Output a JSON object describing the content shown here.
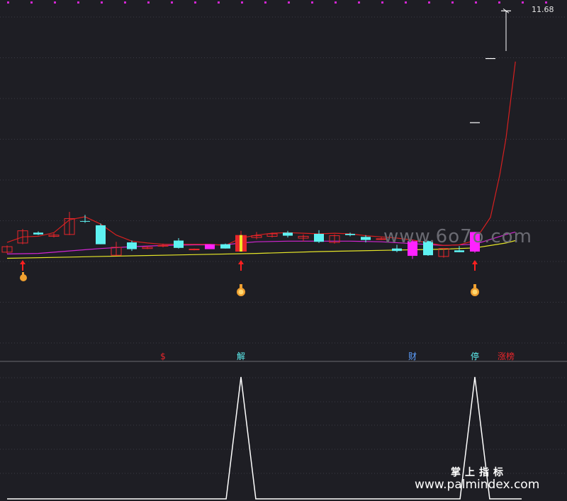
{
  "chart_data": [
    {
      "type": "candlestick",
      "title": "",
      "ylim": [
        6.0,
        11.8
      ],
      "price_high_label": "11.68",
      "colors": {
        "up": "#e8262b",
        "down": "#5ef2f2",
        "limit_up": "#ff22ff",
        "ma_short": "#d62020",
        "ma_mid": "#d226d2",
        "ma_long": "#e6e628",
        "grid": "#3a3a44",
        "separator": "#6a6a70"
      },
      "candles": [
        {
          "i": 0,
          "o": 7.73,
          "c": 7.82,
          "h": 7.84,
          "l": 7.71,
          "dir": "up"
        },
        {
          "i": 1,
          "o": 7.88,
          "c": 8.08,
          "h": 8.11,
          "l": 7.86,
          "dir": "up"
        },
        {
          "i": 2,
          "o": 8.05,
          "c": 8.02,
          "h": 8.07,
          "l": 8.01,
          "dir": "down"
        },
        {
          "i": 3,
          "o": 7.99,
          "c": 8.01,
          "h": 8.04,
          "l": 7.97,
          "dir": "up"
        },
        {
          "i": 4,
          "o": 8.02,
          "c": 8.28,
          "h": 8.39,
          "l": 8.01,
          "dir": "up"
        },
        {
          "i": 5,
          "o": 8.24,
          "c": 8.23,
          "h": 8.34,
          "l": 8.21,
          "dir": "down"
        },
        {
          "i": 6,
          "o": 8.17,
          "c": 7.86,
          "h": 8.2,
          "l": 7.86,
          "dir": "down"
        },
        {
          "i": 7,
          "o": 7.68,
          "c": 7.81,
          "h": 7.9,
          "l": 7.67,
          "dir": "up"
        },
        {
          "i": 8,
          "o": 7.89,
          "c": 7.78,
          "h": 7.92,
          "l": 7.75,
          "dir": "down"
        },
        {
          "i": 9,
          "o": 7.79,
          "c": 7.81,
          "h": 7.83,
          "l": 7.78,
          "dir": "up"
        },
        {
          "i": 10,
          "o": 7.83,
          "c": 7.84,
          "h": 7.87,
          "l": 7.81,
          "dir": "up"
        },
        {
          "i": 11,
          "o": 7.92,
          "c": 7.8,
          "h": 7.96,
          "l": 7.79,
          "dir": "down"
        },
        {
          "i": 12,
          "o": 7.77,
          "c": 7.78,
          "h": 7.79,
          "l": 7.76,
          "dir": "up"
        },
        {
          "i": 13,
          "o": 7.78,
          "c": 7.86,
          "h": 7.86,
          "l": 7.78,
          "dir": "limit_up"
        },
        {
          "i": 14,
          "o": 7.86,
          "c": 7.79,
          "h": 7.87,
          "l": 7.79,
          "dir": "down"
        },
        {
          "i": 15,
          "o": 7.74,
          "c": 8.01,
          "h": 8.08,
          "l": 7.74,
          "dir": "up",
          "highlight": true
        },
        {
          "i": 16,
          "o": 7.97,
          "c": 8.0,
          "h": 8.06,
          "l": 7.94,
          "dir": "up"
        },
        {
          "i": 17,
          "o": 7.99,
          "c": 8.03,
          "h": 8.05,
          "l": 7.97,
          "dir": "up"
        },
        {
          "i": 18,
          "o": 8.05,
          "c": 8.0,
          "h": 8.08,
          "l": 7.97,
          "dir": "down"
        },
        {
          "i": 19,
          "o": 7.96,
          "c": 7.99,
          "h": 8.02,
          "l": 7.91,
          "dir": "up"
        },
        {
          "i": 20,
          "o": 8.03,
          "c": 7.9,
          "h": 8.09,
          "l": 7.88,
          "dir": "down"
        },
        {
          "i": 21,
          "o": 7.89,
          "c": 8.0,
          "h": 8.02,
          "l": 7.87,
          "dir": "up"
        },
        {
          "i": 22,
          "o": 8.03,
          "c": 8.01,
          "h": 8.05,
          "l": 7.99,
          "dir": "down"
        },
        {
          "i": 23,
          "o": 7.98,
          "c": 7.93,
          "h": 8.01,
          "l": 7.89,
          "dir": "down"
        },
        {
          "i": 24,
          "o": 7.94,
          "c": 7.95,
          "h": 7.97,
          "l": 7.93,
          "dir": "up"
        },
        {
          "i": 25,
          "o": 7.79,
          "c": 7.75,
          "h": 7.85,
          "l": 7.73,
          "dir": "down"
        },
        {
          "i": 26,
          "o": 7.67,
          "c": 7.91,
          "h": 7.93,
          "l": 7.62,
          "dir": "limit_up"
        },
        {
          "i": 27,
          "o": 7.91,
          "c": 7.68,
          "h": 7.92,
          "l": 7.67,
          "dir": "down"
        },
        {
          "i": 28,
          "o": 7.66,
          "c": 7.79,
          "h": 7.8,
          "l": 7.64,
          "dir": "up"
        },
        {
          "i": 29,
          "o": 7.76,
          "c": 7.73,
          "h": 7.83,
          "l": 7.73,
          "dir": "down"
        },
        {
          "i": 30,
          "o": 7.74,
          "c": 8.06,
          "h": 8.06,
          "l": 7.72,
          "dir": "limit_up"
        }
      ],
      "limit_dashes": [
        {
          "after": 30,
          "v": 9.85
        },
        {
          "after": 31,
          "v": 10.9
        },
        {
          "after": 32,
          "v": 11.68
        }
      ],
      "ma_short": [
        {
          "i": 0,
          "v": 7.89
        },
        {
          "i": 1,
          "v": 7.98
        },
        {
          "i": 2,
          "v": 7.99
        },
        {
          "i": 3,
          "v": 8.05
        },
        {
          "i": 4,
          "v": 8.26
        },
        {
          "i": 5,
          "v": 8.31
        },
        {
          "i": 6,
          "v": 8.19
        },
        {
          "i": 7,
          "v": 8.01
        },
        {
          "i": 8,
          "v": 7.91
        },
        {
          "i": 9,
          "v": 7.88
        },
        {
          "i": 10,
          "v": 7.86
        },
        {
          "i": 11,
          "v": 7.86
        },
        {
          "i": 12,
          "v": 7.86
        },
        {
          "i": 13,
          "v": 7.86
        },
        {
          "i": 14,
          "v": 7.84
        },
        {
          "i": 15,
          "v": 7.96
        },
        {
          "i": 16,
          "v": 8.01
        },
        {
          "i": 17,
          "v": 8.04
        },
        {
          "i": 18,
          "v": 8.05
        },
        {
          "i": 19,
          "v": 8.04
        },
        {
          "i": 20,
          "v": 8.03
        },
        {
          "i": 21,
          "v": 8.04
        },
        {
          "i": 22,
          "v": 8.03
        },
        {
          "i": 23,
          "v": 8.0
        },
        {
          "i": 24,
          "v": 7.98
        },
        {
          "i": 25,
          "v": 7.96
        },
        {
          "i": 26,
          "v": 7.93
        },
        {
          "i": 27,
          "v": 7.88
        },
        {
          "i": 28,
          "v": 7.84
        },
        {
          "i": 29,
          "v": 7.85
        },
        {
          "i": 30,
          "v": 7.92
        },
        {
          "i": 31,
          "v": 8.3
        },
        {
          "i": 31.6,
          "v": 9.0
        },
        {
          "i": 32,
          "v": 9.6
        },
        {
          "i": 32.6,
          "v": 10.85
        }
      ],
      "ma_mid": [
        {
          "i": 0,
          "v": 7.7
        },
        {
          "i": 2,
          "v": 7.71
        },
        {
          "i": 4,
          "v": 7.75
        },
        {
          "i": 6,
          "v": 7.79
        },
        {
          "i": 8,
          "v": 7.82
        },
        {
          "i": 10,
          "v": 7.84
        },
        {
          "i": 12,
          "v": 7.85
        },
        {
          "i": 14,
          "v": 7.85
        },
        {
          "i": 15,
          "v": 7.88
        },
        {
          "i": 16,
          "v": 7.9
        },
        {
          "i": 18,
          "v": 7.91
        },
        {
          "i": 20,
          "v": 7.91
        },
        {
          "i": 22,
          "v": 7.91
        },
        {
          "i": 24,
          "v": 7.9
        },
        {
          "i": 26,
          "v": 7.87
        },
        {
          "i": 28,
          "v": 7.84
        },
        {
          "i": 30,
          "v": 7.86
        },
        {
          "i": 31,
          "v": 7.94
        },
        {
          "i": 32,
          "v": 8.02
        },
        {
          "i": 32.6,
          "v": 8.06
        }
      ],
      "ma_long": [
        {
          "i": 0,
          "v": 7.63
        },
        {
          "i": 4,
          "v": 7.65
        },
        {
          "i": 8,
          "v": 7.67
        },
        {
          "i": 12,
          "v": 7.69
        },
        {
          "i": 16,
          "v": 7.71
        },
        {
          "i": 20,
          "v": 7.74
        },
        {
          "i": 24,
          "v": 7.76
        },
        {
          "i": 28,
          "v": 7.78
        },
        {
          "i": 30,
          "v": 7.8
        },
        {
          "i": 31,
          "v": 7.84
        },
        {
          "i": 32,
          "v": 7.88
        },
        {
          "i": 32.6,
          "v": 7.92
        }
      ],
      "signal_markers": [
        {
          "i": 1,
          "type": "arrow-hand"
        },
        {
          "i": 15,
          "type": "arrow-moneybag"
        },
        {
          "i": 30,
          "type": "arrow-moneybag"
        }
      ],
      "event_tags": [
        {
          "i": 10,
          "text": "$",
          "color": "#e8262b"
        },
        {
          "i": 15,
          "text": "解",
          "color": "#5ef2f2"
        },
        {
          "i": 26,
          "text": "财",
          "color": "#5ea0ff"
        },
        {
          "i": 30,
          "text": "停",
          "color": "#5ef2f2"
        },
        {
          "i": 32,
          "text": "涨榜",
          "color": "#e8262b"
        }
      ]
    },
    {
      "type": "line",
      "title": "",
      "ylim": [
        0,
        1
      ],
      "x": [
        0,
        14.05,
        15,
        15.95,
        29.05,
        30,
        30.95,
        33
      ],
      "y": [
        0,
        0,
        1,
        0,
        0,
        1,
        0,
        0
      ],
      "color": "#ffffff"
    }
  ],
  "watermark": {
    "site_large": "www.6o7o.com",
    "brand_cn": "掌上指标",
    "site_small": "www.palmindex.com"
  }
}
